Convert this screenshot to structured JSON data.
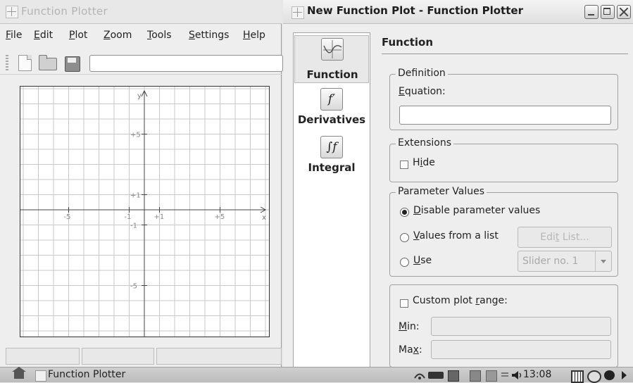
{
  "main_window": {
    "title": "Function Plotter",
    "menu": [
      {
        "pre": "",
        "u": "F",
        "post": "ile"
      },
      {
        "pre": "",
        "u": "E",
        "post": "dit"
      },
      {
        "pre": "",
        "u": "P",
        "post": "lot"
      },
      {
        "pre": "",
        "u": "Z",
        "post": "oom"
      },
      {
        "pre": "",
        "u": "T",
        "post": "ools"
      },
      {
        "pre": "",
        "u": "S",
        "post": "ettings"
      },
      {
        "pre": "",
        "u": "H",
        "post": "elp"
      }
    ],
    "toolbar_input_value": "",
    "toolbar_icons": [
      "new-document-icon",
      "open-folder-icon",
      "save-disk-icon"
    ]
  },
  "chart_data": {
    "type": "scatter",
    "series": [],
    "xlim": [
      -8.5,
      8.5
    ],
    "ylim": [
      -8.5,
      8.5
    ],
    "grid": true,
    "axis_labels": {
      "x": "x",
      "y": "y"
    },
    "x_ticks": [
      "-5",
      "-1",
      "+1",
      "+5"
    ],
    "y_ticks": [
      "+5",
      "+1",
      "-1",
      "-5"
    ]
  },
  "dialog": {
    "title": "New Function Plot - Function Plotter",
    "pages": [
      {
        "label": "Function",
        "icon": "function-graph-icon",
        "selected": true
      },
      {
        "label": "Derivatives",
        "icon": "derivative-f-prime-icon",
        "glyph": "f′",
        "selected": false
      },
      {
        "label": "Integral",
        "icon": "integral-icon",
        "glyph": "∫f",
        "selected": false
      }
    ],
    "section_title": "Function",
    "definition": {
      "legend": "Definition",
      "equation_label_u": "E",
      "equation_label_rest": "quation:",
      "equation_value": ""
    },
    "extensions": {
      "legend": "Extensions",
      "hide_pre": "H",
      "hide_u": "i",
      "hide_post": "de",
      "hide_checked": false
    },
    "parameters": {
      "legend": "Parameter Values",
      "disable_u": "D",
      "disable_rest": "isable parameter values",
      "list_u": "V",
      "list_rest": "alues from a list",
      "use_u": "U",
      "use_rest": "se",
      "edit_list_pre": "Edi",
      "edit_list_u": "t",
      "edit_list_post": " List...",
      "slider_value": "Slider no. 1",
      "selected": "disable"
    },
    "range": {
      "custom_pre": "Custom plot ",
      "custom_u": "r",
      "custom_post": "ange:",
      "custom_checked": false,
      "min_u": "M",
      "min_rest": "in:",
      "max_pre": "Ma",
      "max_u": "x",
      "max_post": ":",
      "min_value": "",
      "max_value": ""
    }
  },
  "taskbar": {
    "task_label": "Function Plotter",
    "clock": "13:08",
    "tray_icons": [
      "network-icon",
      "battery-icon",
      "display-icon",
      "klipper-icon",
      "font-icon",
      "keyboard-icon",
      "volume-icon",
      "calendar-icon",
      "smiley-icon",
      "power-icon",
      "arrow-icon"
    ]
  }
}
